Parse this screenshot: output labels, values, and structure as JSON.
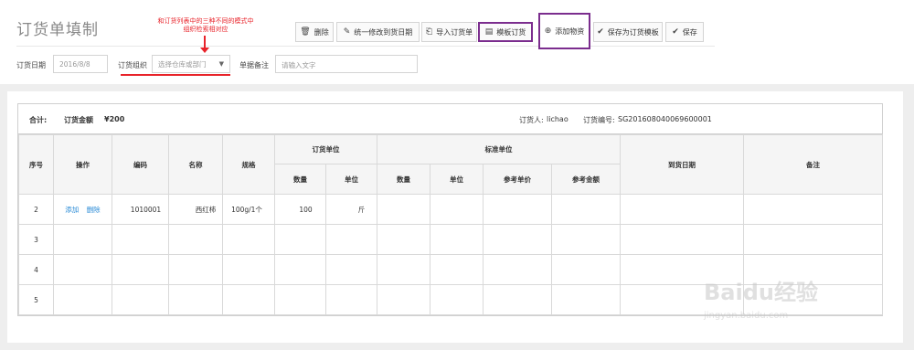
{
  "page": {
    "title": "订货单填制"
  },
  "annotation": {
    "text": "和订货列表中的三种不同的模式中组织检索相对应"
  },
  "toolbar": {
    "delete_label": "删除",
    "unify_date_label": "统一修改到货日期",
    "import_label": "导入订货单",
    "template_order_label": "模板订货",
    "add_material_label": "添加物资",
    "save_template_label": "保存为订货模板",
    "save_label": "保存"
  },
  "form": {
    "order_date_label": "订货日期",
    "order_date_value": "2016/8/8",
    "org_label": "订货组织",
    "org_placeholder": "选择仓库或部门",
    "remark_label": "单据备注",
    "remark_placeholder": "请输入文字"
  },
  "summary": {
    "total_label": "合计:",
    "amount_label": "订货金额",
    "amount_value": "¥200",
    "orderer_label": "订货人:",
    "orderer_value": "lichao",
    "order_no_label": "订货编号:",
    "order_no_value": "SG201608040069600001"
  },
  "table": {
    "headers": {
      "index": "序号",
      "ops": "操作",
      "code": "编码",
      "name": "名称",
      "spec": "规格",
      "order_unit": "订货单位",
      "std_unit": "标准单位",
      "arrival_date": "到货日期",
      "remark": "备注",
      "qty": "数量",
      "unit": "单位",
      "ref_price": "参考单价",
      "ref_amount": "参考金额"
    },
    "ops": {
      "add": "添加",
      "delete": "删除"
    },
    "rows": [
      {
        "index": "2",
        "code": "1010001",
        "name": "西红柿",
        "spec": "100g/1个",
        "qty": "100",
        "unit": "斤"
      },
      {
        "index": "3"
      },
      {
        "index": "4"
      },
      {
        "index": "5"
      }
    ]
  },
  "watermark": {
    "logo": "Baidu经验",
    "url": "jingyan.baidu.com"
  },
  "colors": {
    "highlight": "#7b2d8e",
    "annotation": "#e8232a",
    "link": "#2a8bd6"
  }
}
